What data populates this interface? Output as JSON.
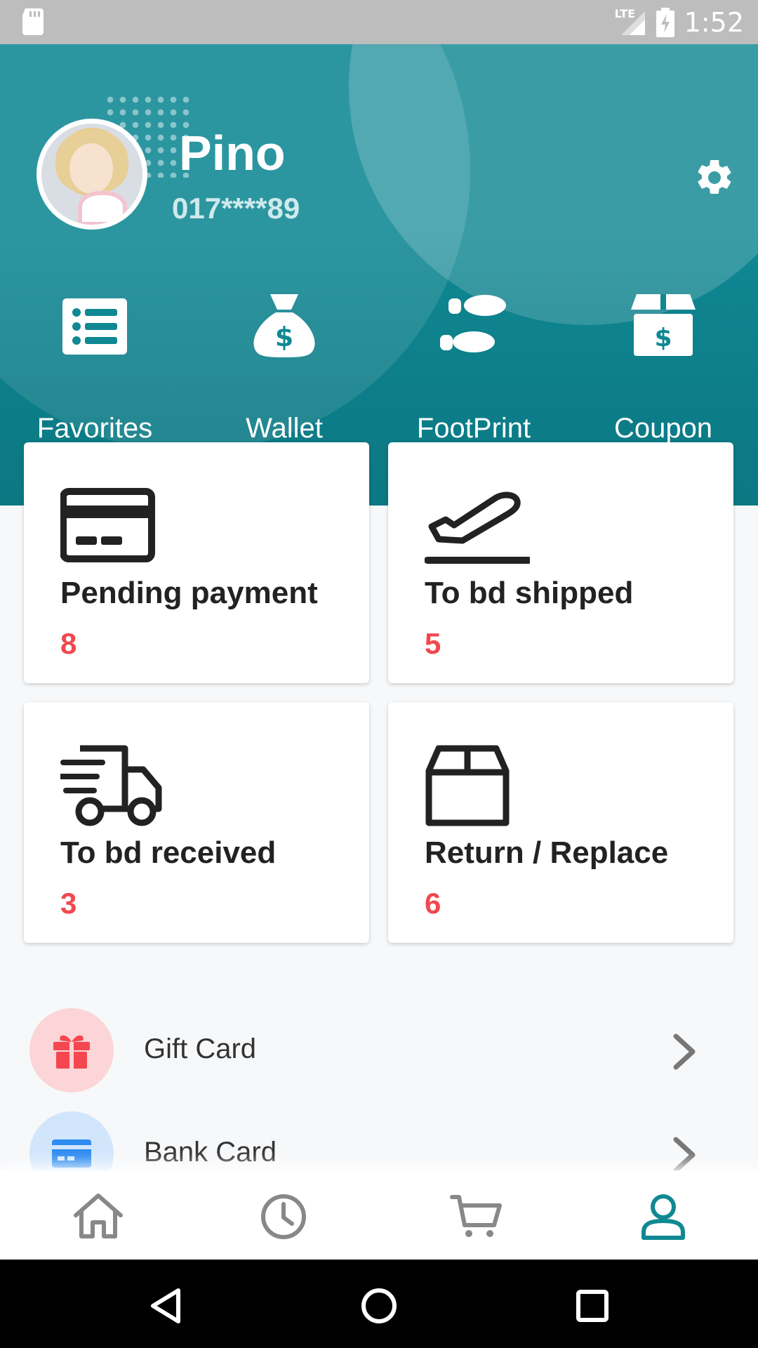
{
  "status_bar": {
    "time": "1:52",
    "network": "LTE"
  },
  "profile": {
    "name": "Pino",
    "phone": "017****89"
  },
  "quick_actions": [
    {
      "label": "Favorites",
      "icon": "list-icon"
    },
    {
      "label": "Wallet",
      "icon": "money-bag-icon"
    },
    {
      "label": "FootPrint",
      "icon": "footprint-icon"
    },
    {
      "label": "Coupon",
      "icon": "coupon-box-icon"
    }
  ],
  "order_cards": [
    {
      "title": "Pending payment",
      "count": "8",
      "icon": "credit-card-icon"
    },
    {
      "title": "To bd shipped",
      "count": "5",
      "icon": "airplane-departure-icon"
    },
    {
      "title": "To bd received",
      "count": "3",
      "icon": "delivery-truck-icon"
    },
    {
      "title": "Return / Replace",
      "count": "6",
      "icon": "box-icon"
    }
  ],
  "menu_list": [
    {
      "label": "Gift Card",
      "icon": "gift-icon",
      "color": "#f4474f",
      "bg": "#fbd5d7"
    },
    {
      "label": "Bank Card",
      "icon": "bank-card-icon",
      "color": "#2d8cf0",
      "bg": "#d2e6fb"
    }
  ],
  "bottom_nav": [
    {
      "name": "home",
      "icon": "home-icon",
      "active": false
    },
    {
      "name": "history",
      "icon": "clock-icon",
      "active": false
    },
    {
      "name": "cart",
      "icon": "cart-icon",
      "active": false
    },
    {
      "name": "profile",
      "icon": "user-icon",
      "active": true
    }
  ],
  "colors": {
    "primary": "#0f8893",
    "accent_red": "#f0484f",
    "nav_inactive": "#888888"
  }
}
